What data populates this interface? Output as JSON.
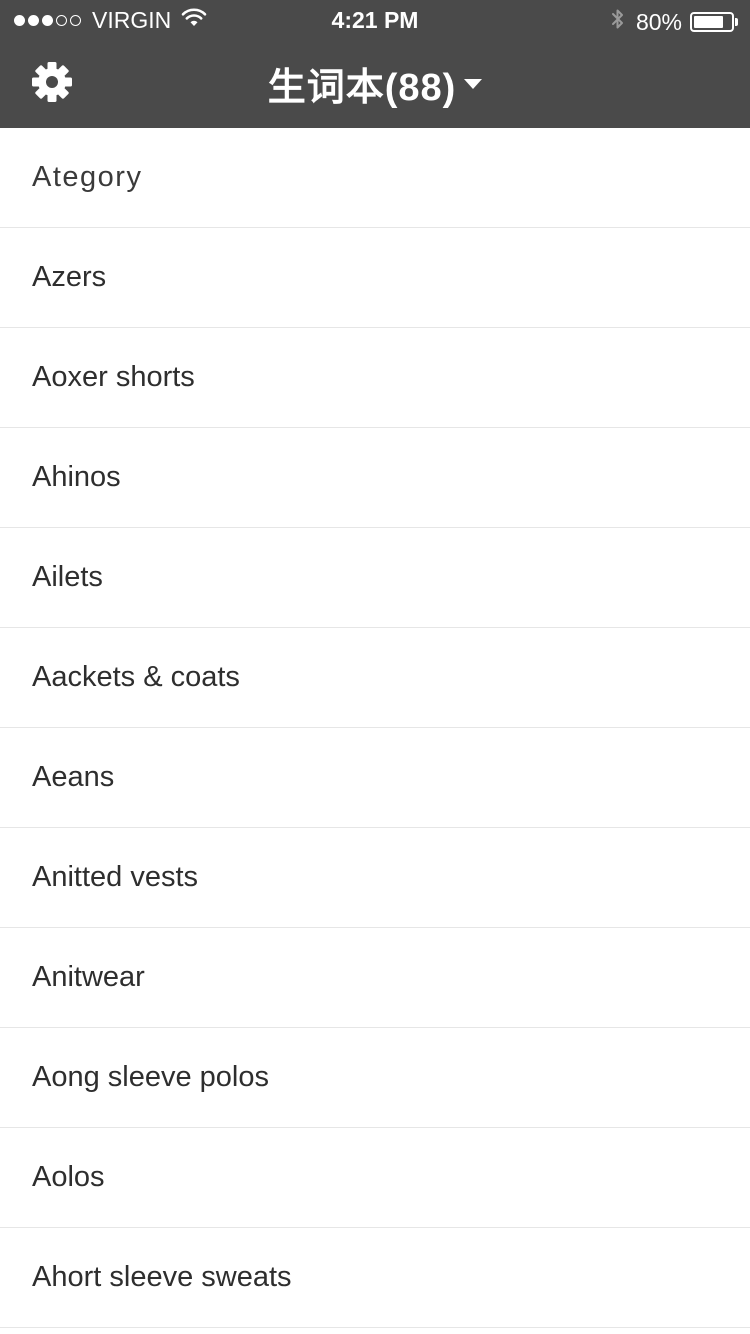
{
  "status_bar": {
    "signal_dots_filled": 3,
    "signal_dots_empty": 2,
    "carrier": "VIRGIN",
    "wifi_icon": "wifi-icon",
    "time": "4:21 PM",
    "bluetooth_icon": "bluetooth-icon",
    "battery_percent": "80%",
    "battery_level": 0.8
  },
  "header": {
    "settings_icon": "gear-icon",
    "title": "生词本(88)",
    "dropdown_icon": "caret-down-icon",
    "background_color": "#4a4a4a"
  },
  "list": {
    "items": [
      {
        "label": "Ategory"
      },
      {
        "label": "Azers"
      },
      {
        "label": "Aoxer shorts"
      },
      {
        "label": "Ahinos"
      },
      {
        "label": "Ailets"
      },
      {
        "label": "Aackets & coats"
      },
      {
        "label": "Aeans"
      },
      {
        "label": "Anitted vests"
      },
      {
        "label": "Anitwear"
      },
      {
        "label": "Aong sleeve polos"
      },
      {
        "label": "Aolos"
      },
      {
        "label": "Ahort sleeve sweats"
      }
    ]
  }
}
